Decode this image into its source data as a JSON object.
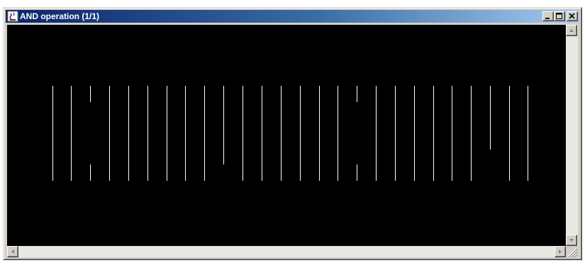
{
  "window": {
    "title": "AND operation (1/1)",
    "icon": "java-applet-icon",
    "buttons": [
      "minimize-icon",
      "maximize-icon",
      "close-icon"
    ]
  },
  "colors": {
    "canvas_background": "#000000",
    "line_color": "#ffffff",
    "titlebar_start": "#0a246a",
    "titlebar_end": "#a6caf0"
  },
  "display": {
    "description_of_signals": "Vertical white traces on a black canvas representing signal columns"
  }
}
